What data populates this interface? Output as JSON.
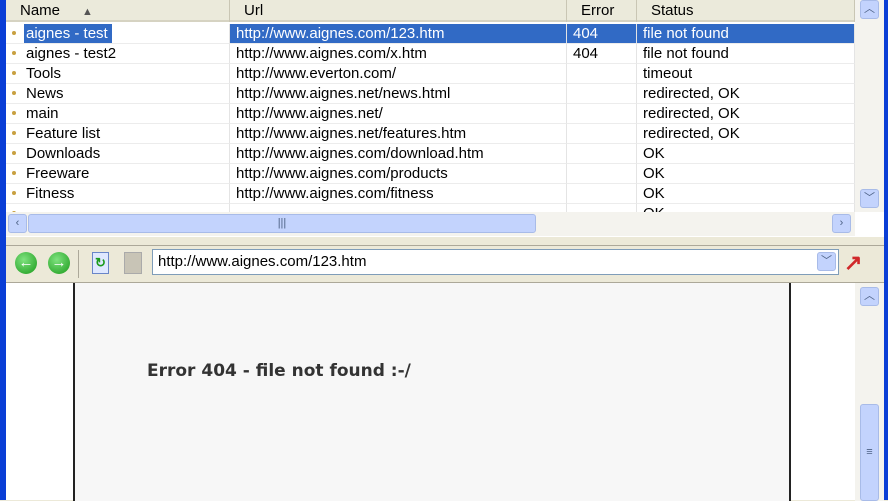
{
  "list": {
    "columns": [
      "Name",
      "Url",
      "Error",
      "Status"
    ],
    "sort_indicator": "▲",
    "rows": [
      {
        "name": "aignes - test",
        "url": "http://www.aignes.com/123.htm",
        "error": "404",
        "status": "file not found"
      },
      {
        "name": "aignes - test2",
        "url": "http://www.aignes.com/x.htm",
        "error": "404",
        "status": "file not found"
      },
      {
        "name": "Tools",
        "url": "http://www.everton.com/",
        "error": "",
        "status": "timeout"
      },
      {
        "name": "News",
        "url": "http://www.aignes.net/news.html",
        "error": "",
        "status": "redirected, OK"
      },
      {
        "name": "main",
        "url": "http://www.aignes.net/",
        "error": "",
        "status": "redirected, OK"
      },
      {
        "name": "Feature list",
        "url": "http://www.aignes.net/features.htm",
        "error": "",
        "status": "redirected, OK"
      },
      {
        "name": "Downloads",
        "url": "http://www.aignes.com/download.htm",
        "error": "",
        "status": "OK"
      },
      {
        "name": "Freeware",
        "url": "http://www.aignes.com/products",
        "error": "",
        "status": "OK"
      },
      {
        "name": "Fitness",
        "url": "http://www.aignes.com/fitness",
        "error": "",
        "status": "OK"
      },
      {
        "name": "",
        "url": "",
        "error": "",
        "status": "OK"
      }
    ]
  },
  "toolbar": {
    "url_value": "http://www.aignes.com/123.htm"
  },
  "viewer": {
    "message": "Error 404 - file not found  :-/"
  }
}
